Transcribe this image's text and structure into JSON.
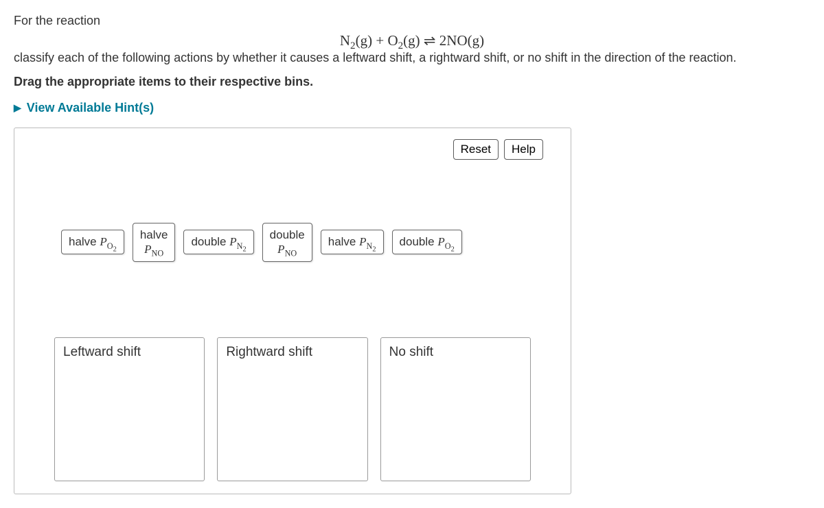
{
  "intro": {
    "line1": "For the reaction",
    "line2": "classify each of the following actions by whether it causes a leftward shift, a rightward shift, or no shift in the direction of the reaction."
  },
  "equation": {
    "reactant1": "N",
    "reactant1_sub": "2",
    "reactant1_state": "(g)",
    "plus": " + ",
    "reactant2": "O",
    "reactant2_sub": "2",
    "reactant2_state": "(g)",
    "eq_symbol": " ⇌ ",
    "product_coef": "2",
    "product": "NO",
    "product_state": "(g)"
  },
  "instruction": "Drag the appropriate items to their respective bins.",
  "hints_label": "View Available Hint(s)",
  "buttons": {
    "reset": "Reset",
    "help": "Help"
  },
  "drag_items": [
    {
      "action": "halve ",
      "P": "P",
      "sub": "O",
      "sub2": "2"
    },
    {
      "action": "halve",
      "P": "P",
      "sub": "NO",
      "sub2": ""
    },
    {
      "action": "double ",
      "P": "P",
      "sub": "N",
      "sub2": "2"
    },
    {
      "action": "double",
      "P": "P",
      "sub": "NO",
      "sub2": ""
    },
    {
      "action": "halve ",
      "P": "P",
      "sub": "N",
      "sub2": "2"
    },
    {
      "action": "double ",
      "P": "P",
      "sub": "O",
      "sub2": "2"
    }
  ],
  "bins": [
    {
      "label": "Leftward shift"
    },
    {
      "label": "Rightward shift"
    },
    {
      "label": "No shift"
    }
  ]
}
